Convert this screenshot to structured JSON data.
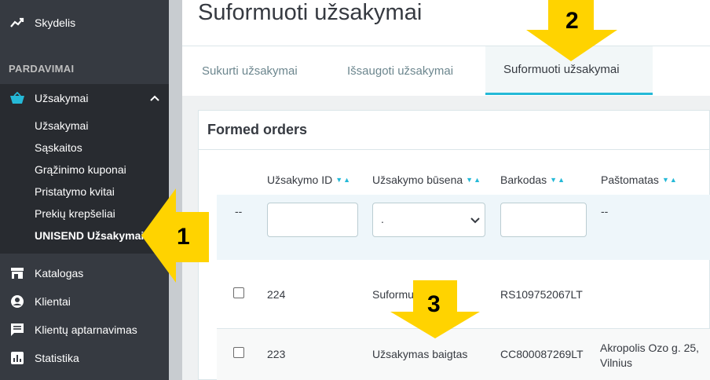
{
  "sidebar": {
    "dashboard_label": "Skydelis",
    "section_sales": "PARDAVIMAI",
    "orders_label": "Užsakymai",
    "sub_items": [
      {
        "label": "Užsakymai"
      },
      {
        "label": "Sąskaitos"
      },
      {
        "label": "Grąžinimo kuponai"
      },
      {
        "label": "Pristatymo kvitai"
      },
      {
        "label": "Prekių krepšeliai"
      },
      {
        "label": "UNISEND Užsakymai"
      }
    ],
    "catalog_label": "Katalogas",
    "customers_label": "Klientai",
    "service_label": "Klientų aptarnavimas",
    "stats_label": "Statistika"
  },
  "header": {
    "title": "Suformuoti užsakymai"
  },
  "tabs": [
    {
      "label": "Sukurti užsakymai"
    },
    {
      "label": "Išsaugoti užsakymai"
    },
    {
      "label": "Suformuoti užsakymai"
    }
  ],
  "panel": {
    "title": "Formed orders",
    "columns": [
      {
        "label": "Užsakymo ID"
      },
      {
        "label": "Užsakymo būsena"
      },
      {
        "label": "Barkodas"
      },
      {
        "label": "Paštomatas"
      }
    ],
    "filter": {
      "select_value": ".",
      "dash_left": "--",
      "dash_right": "--"
    },
    "rows": [
      {
        "id": "224",
        "status": "Suformu",
        "barcode": "RS109752067LT",
        "locker": ""
      },
      {
        "id": "223",
        "status": "Užsakymas baigtas",
        "barcode": "CC800087269LT",
        "locker": "Akropolis Ozo g. 25, Vilnius"
      }
    ]
  },
  "annotations": {
    "one": "1",
    "two": "2",
    "three": "3",
    "color": "#ffd300"
  },
  "colors": {
    "accent": "#25b9d7",
    "sidebar_bg": "#363a41"
  }
}
